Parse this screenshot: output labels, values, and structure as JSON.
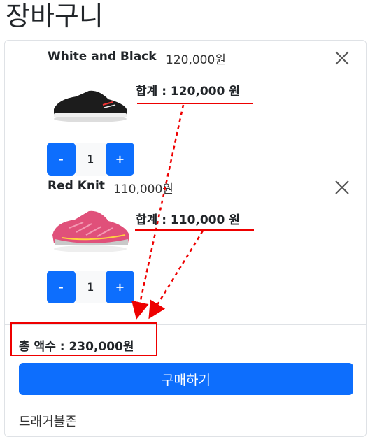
{
  "page": {
    "title": "장바구니"
  },
  "cart": {
    "items": [
      {
        "name": "White and Black",
        "price": "120,000원",
        "subtotal": "합계 : 120,000 원",
        "quantity": "1",
        "minus_label": "-",
        "plus_label": "+"
      },
      {
        "name": "Red Knit",
        "price": "110,000원",
        "subtotal": "합계 : 110,000 원",
        "quantity": "1",
        "minus_label": "-",
        "plus_label": "+"
      }
    ],
    "total": "총 액수 : 230,000원",
    "buy_label": "구매하기",
    "footer": "드래거블존"
  },
  "colors": {
    "accent": "#0d6efd",
    "annotation": "#e00000"
  }
}
